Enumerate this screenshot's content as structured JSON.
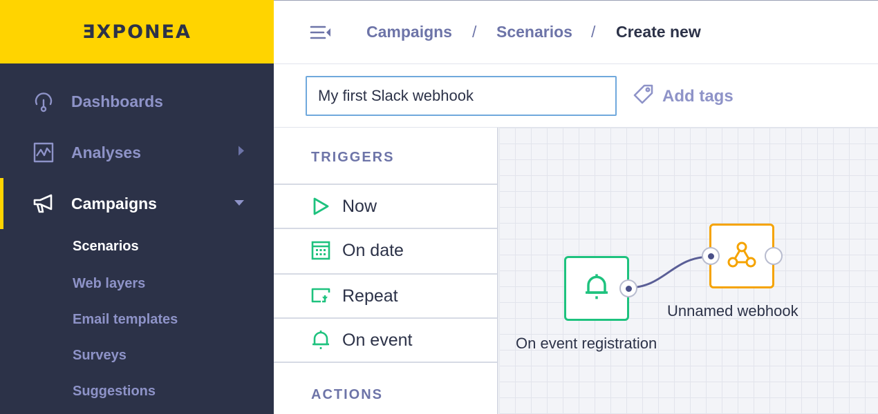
{
  "logo": {
    "text": "ƎXPONEA"
  },
  "sidebar": {
    "items": [
      {
        "label": "Dashboards",
        "icon": "gauge-icon"
      },
      {
        "label": "Analyses",
        "icon": "chart-icon",
        "has_submenu": true
      },
      {
        "label": "Campaigns",
        "icon": "megaphone-icon",
        "active": true,
        "expanded": true
      }
    ],
    "sub_items": [
      {
        "label": "Scenarios",
        "active": true
      },
      {
        "label": "Web layers"
      },
      {
        "label": "Email templates"
      },
      {
        "label": "Surveys"
      },
      {
        "label": "Suggestions"
      }
    ]
  },
  "header": {
    "breadcrumb": [
      "Campaigns",
      "Scenarios",
      "Create new"
    ],
    "separator": "/"
  },
  "scenario": {
    "name_value": "My first Slack webhook",
    "add_tags_label": "Add tags"
  },
  "panel": {
    "triggers_title": "TRIGGERS",
    "triggers": [
      {
        "label": "Now",
        "icon": "play-icon"
      },
      {
        "label": "On date",
        "icon": "calendar-icon"
      },
      {
        "label": "Repeat",
        "icon": "repeat-icon"
      },
      {
        "label": "On event",
        "icon": "bell-icon"
      }
    ],
    "actions_title": "ACTIONS"
  },
  "canvas": {
    "nodes": [
      {
        "label": "On event registration",
        "icon": "bell-icon",
        "kind": "trigger"
      },
      {
        "label": "Unnamed webhook",
        "icon": "webhook-icon",
        "kind": "webhook"
      }
    ]
  },
  "colors": {
    "brand_yellow": "#FFD400",
    "sidebar_bg": "#2C3248",
    "trigger_green": "#1EC27E",
    "webhook_orange": "#F5A300",
    "link_purple": "#6D74A8"
  }
}
